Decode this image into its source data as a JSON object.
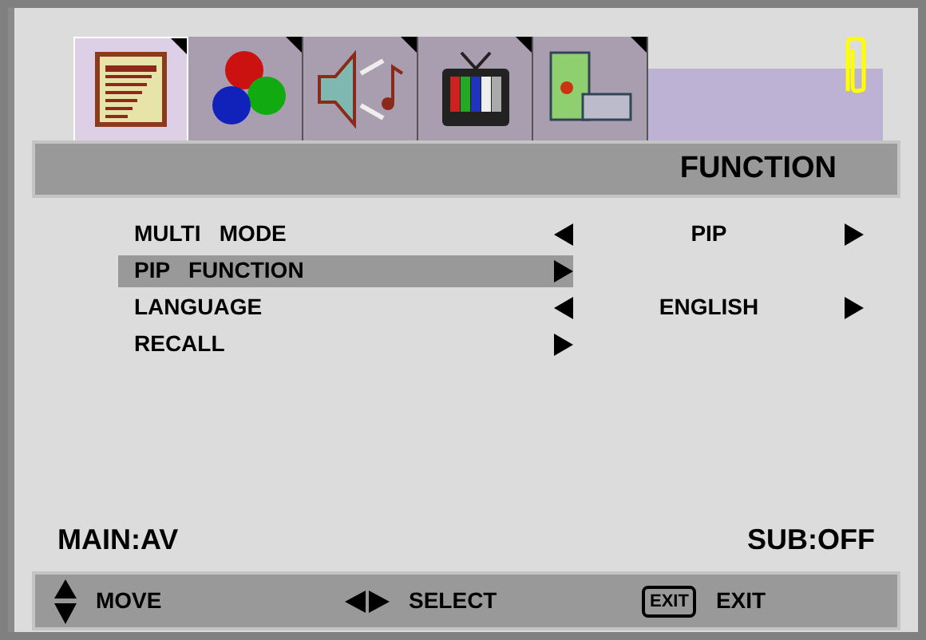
{
  "tabs": [
    {
      "kind": "notes",
      "selected": true
    },
    {
      "kind": "colors",
      "selected": false
    },
    {
      "kind": "sound",
      "selected": false
    },
    {
      "kind": "tv",
      "selected": false
    },
    {
      "kind": "computer",
      "selected": false
    }
  ],
  "title": "FUNCTION",
  "menu": [
    {
      "kind": "option",
      "label": "MULTI   MODE",
      "value": "PIP",
      "selected": false
    },
    {
      "kind": "submenu",
      "label": "PIP   FUNCTION",
      "selected": true
    },
    {
      "kind": "option",
      "label": "LANGUAGE",
      "value": "ENGLISH",
      "selected": false
    },
    {
      "kind": "submenu",
      "label": "RECALL",
      "selected": false
    }
  ],
  "status": {
    "main": "MAIN:AV",
    "sub": "SUB:OFF"
  },
  "hints": [
    {
      "kind": "updown",
      "label": "MOVE"
    },
    {
      "kind": "leftright",
      "label": "SELECT"
    },
    {
      "kind": "key",
      "key": "EXIT",
      "label": "EXIT"
    }
  ]
}
